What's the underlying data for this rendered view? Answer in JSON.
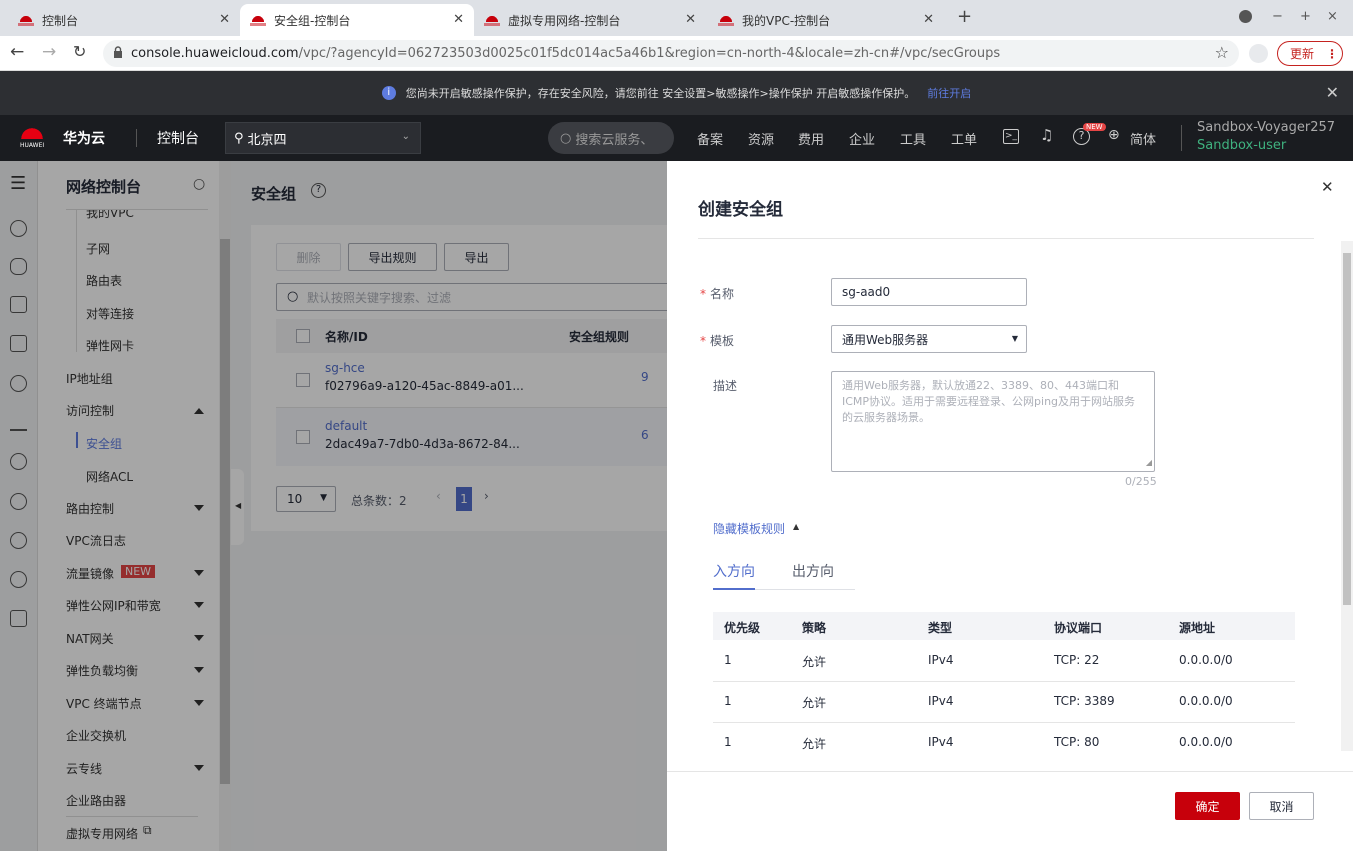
{
  "browser": {
    "tabs": [
      {
        "title": "控制台",
        "active": false
      },
      {
        "title": "安全组-控制台",
        "active": true
      },
      {
        "title": "虚拟专用网络-控制台",
        "active": false
      },
      {
        "title": "我的VPC-控制台",
        "active": false
      }
    ],
    "url_host": "console.huaweicloud.com",
    "url_path": "/vpc/?agencyId=062723503d0025c01f5dc014ac5a46b1&region=cn-north-4&locale=zh-cn#/vpc/secGroups",
    "update_label": "更新",
    "win_controls": [
      "−",
      "+",
      "×"
    ]
  },
  "banner": {
    "text": "您尚未开启敏感操作保护，存在安全风险，请您前往 安全设置>敏感操作>操作保护 开启敏感操作保护。",
    "link": "前往开启"
  },
  "header": {
    "brand": "华为云",
    "brand_small": "HUAWEI",
    "console": "控制台",
    "region": "北京四",
    "search_placeholder": "搜索云服务、",
    "menu": [
      "备案",
      "资源",
      "费用",
      "企业",
      "工具",
      "工单"
    ],
    "lang": "简体",
    "badge": "NEW",
    "account": "Sandbox-Voyager257",
    "user": "Sandbox-user"
  },
  "sidebar": {
    "title": "网络控制台",
    "items": [
      {
        "label": "我的VPC",
        "sub": true
      },
      {
        "label": "子网",
        "sub": true
      },
      {
        "label": "路由表",
        "sub": true
      },
      {
        "label": "对等连接",
        "sub": true
      },
      {
        "label": "弹性网卡",
        "sub": true
      },
      {
        "label": "IP地址组",
        "sub": false
      },
      {
        "label": "访问控制",
        "sub": false,
        "expanded": true
      },
      {
        "label": "安全组",
        "sub": true,
        "selected": true
      },
      {
        "label": "网络ACL",
        "sub": true
      },
      {
        "label": "路由控制",
        "sub": false
      },
      {
        "label": "VPC流日志",
        "sub": false
      },
      {
        "label": "流量镜像",
        "sub": false,
        "badge": "NEW"
      },
      {
        "label": "弹性公网IP和带宽",
        "sub": false
      },
      {
        "label": "NAT网关",
        "sub": false
      },
      {
        "label": "弹性负载均衡",
        "sub": false
      },
      {
        "label": "VPC 终端节点",
        "sub": false
      },
      {
        "label": "企业交换机",
        "sub": false
      },
      {
        "label": "云专线",
        "sub": false
      },
      {
        "label": "企业路由器",
        "sub": false
      },
      {
        "label": "虚拟专用网络",
        "sub": false
      }
    ]
  },
  "main": {
    "title": "安全组",
    "buttons": {
      "delete": "删除",
      "export_rules": "导出规则",
      "export": "导出"
    },
    "search_placeholder": "默认按照关键字搜索、过滤",
    "columns": {
      "name": "名称/ID",
      "rules": "安全组规则"
    },
    "rows": [
      {
        "name": "sg-hce",
        "id": "f02796a9-a120-45ac-8849-a01...",
        "rules": "9"
      },
      {
        "name": "default",
        "id": "2dac49a7-7db0-4d3a-8672-84...",
        "rules": "6"
      }
    ],
    "page_size": "10",
    "total": "总条数：2",
    "page": "1"
  },
  "drawer": {
    "title": "创建安全组",
    "name_label": "名称",
    "name_value": "sg-aad0",
    "template_label": "模板",
    "template_value": "通用Web服务器",
    "desc_label": "描述",
    "desc_placeholder": "通用Web服务器，默认放通22、3389、80、443端口和ICMP协议。适用于需要远程登录、公网ping及用于网站服务的云服务器场景。",
    "desc_count": "0/255",
    "toggle_rules": "隐藏模板规则",
    "tabs": [
      "入方向",
      "出方向"
    ],
    "table_headers": [
      "优先级",
      "策略",
      "类型",
      "协议端口",
      "源地址"
    ],
    "table_rows": [
      [
        "1",
        "允许",
        "IPv4",
        "TCP: 22",
        "0.0.0.0/0"
      ],
      [
        "1",
        "允许",
        "IPv4",
        "TCP: 3389",
        "0.0.0.0/0"
      ],
      [
        "1",
        "允许",
        "IPv4",
        "TCP: 80",
        "0.0.0.0/0"
      ]
    ],
    "confirm": "确定",
    "cancel": "取消"
  }
}
